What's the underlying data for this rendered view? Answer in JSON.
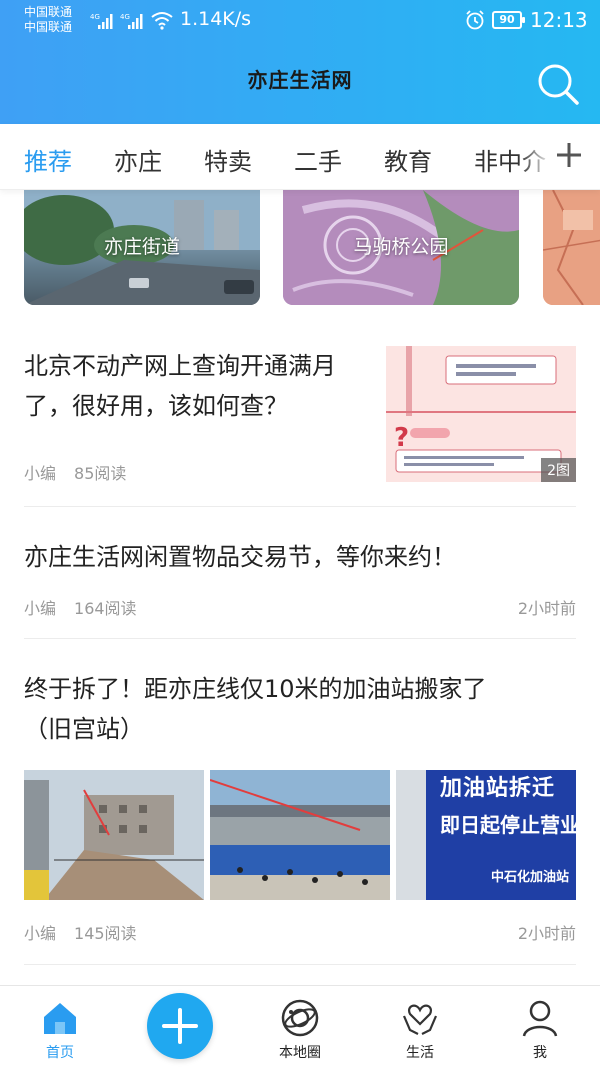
{
  "status_bar": {
    "carrier_1": "中国联通",
    "carrier_2": "中国联通",
    "net_1": "4G",
    "net_2": "4G",
    "speed": "1.14K/s",
    "battery": "90",
    "time": "12:13"
  },
  "header": {
    "title": "亦庄生活网",
    "search_icon": "search-icon"
  },
  "tabs": [
    {
      "label": "推荐",
      "active": true
    },
    {
      "label": "亦庄",
      "active": false
    },
    {
      "label": "特卖",
      "active": false
    },
    {
      "label": "二手",
      "active": false
    },
    {
      "label": "教育",
      "active": false
    },
    {
      "label": "非中介",
      "active": false
    }
  ],
  "tab_add_icon": "plus-icon",
  "topic_cards": [
    {
      "label": "亦庄街道"
    },
    {
      "label": "马驹桥公园"
    },
    {
      "label": ""
    }
  ],
  "articles": [
    {
      "title_line1": "北京不动产网上查询开通满月",
      "title_line2": "了，很好用，该如何查？",
      "author": "小编",
      "reads": "85阅读",
      "pic_count": "2图"
    },
    {
      "title": "亦庄生活网闲置物品交易节，等你来约！",
      "author": "小编",
      "reads": "164阅读",
      "time": "2小时前"
    },
    {
      "title_line1": "终于拆了！距亦庄线仅10米的加油站搬家了",
      "title_line2": "（旧宫站）",
      "author": "小编",
      "reads": "145阅读",
      "time": "2小时前",
      "sign_line1": "加油站拆迁",
      "sign_line2": "即日起停止营业",
      "sign_line3": "中石化加油站"
    }
  ],
  "bottom_nav": [
    {
      "label": "首页",
      "icon": "home-icon",
      "active": true
    },
    {
      "label": "",
      "icon": "plus-icon"
    },
    {
      "label": "本地圈",
      "icon": "planet-icon"
    },
    {
      "label": "生活",
      "icon": "hands-heart-icon"
    },
    {
      "label": "我",
      "icon": "user-icon"
    }
  ],
  "colors": {
    "accent": "#2a9cf0",
    "header_start": "#3fa0f5",
    "header_end": "#25b8f2"
  }
}
